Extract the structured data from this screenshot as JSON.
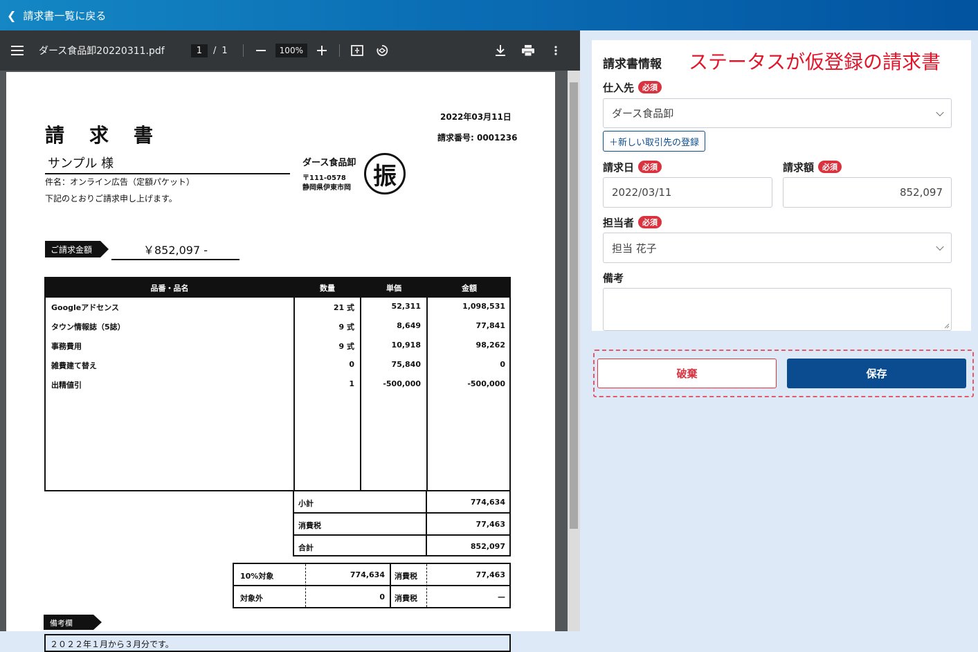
{
  "topbar": {
    "back_label": "請求書一覧に戻る"
  },
  "pdf_viewer": {
    "filename": "ダース食品卸20220311.pdf",
    "page_current": "1",
    "page_sep": "/",
    "page_total": "1",
    "zoom": "100%",
    "icons": [
      "menu-icon",
      "minus-icon",
      "plus-icon",
      "fit-page-icon",
      "rotate-icon",
      "download-icon",
      "print-icon",
      "more-vert-icon"
    ]
  },
  "invoice": {
    "date": "2022年03月11日",
    "title": "請　求　書",
    "number": "請求番号: 0001236",
    "recipient": "サンプル 様",
    "subject": "件名：オンライン広告（定額パケット）",
    "intro": "下記のとおりご請求申し上げます。",
    "amount_tag": "ご請求金額",
    "amount": "￥852,097 -",
    "seller_name": "ダース食品卸",
    "seller_postal": "〒111-0578",
    "seller_address": "静岡県伊東市岡",
    "stamp": "振",
    "headers": [
      "品番・品名",
      "数量",
      "単価",
      "金額"
    ],
    "rows": [
      [
        "Googleアドセンス",
        "21 式",
        "52,311",
        "1,098,531"
      ],
      [
        "タウン情報誌（5誌）",
        "9 式",
        "8,649",
        "77,841"
      ],
      [
        "事務費用",
        "9 式",
        "10,918",
        "98,262"
      ],
      [
        "雑費建て替え",
        "0",
        "75,840",
        "0"
      ],
      [
        "出精値引",
        "1",
        "-500,000",
        "-500,000"
      ]
    ],
    "subtotal_label": "小計",
    "subtotal": "774,634",
    "tax_label": "消費税",
    "tax": "77,463",
    "total_label": "合計",
    "total": "852,097",
    "tax_breakdown": [
      {
        "label": "10%対象",
        "amount": "774,634",
        "tax_label": "消費税",
        "tax": "77,463"
      },
      {
        "label": "対象外",
        "amount": "0",
        "tax_label": "消費税",
        "tax": "—"
      }
    ],
    "notes_tag": "備考欄",
    "notes": "２０２２年１月から３月分です。"
  },
  "form": {
    "section_title": "請求書情報",
    "annotation": "ステータスが仮登録の請求書",
    "required_badge": "必須",
    "supplier_label": "仕入先",
    "supplier_value": "ダース食品卸",
    "new_partner_button": "＋新しい取引先の登録",
    "date_label": "請求日",
    "date_value": "2022/03/11",
    "amount_label": "請求額",
    "amount_value": "852,097",
    "person_label": "担当者",
    "person_value": "担当 花子",
    "remarks_label": "備考",
    "remarks_value": "",
    "discard_button": "破棄",
    "save_button": "保存"
  },
  "colors": {
    "accent": "#0b4b8f",
    "danger": "#d9333f",
    "annotation": "#e0162b"
  }
}
